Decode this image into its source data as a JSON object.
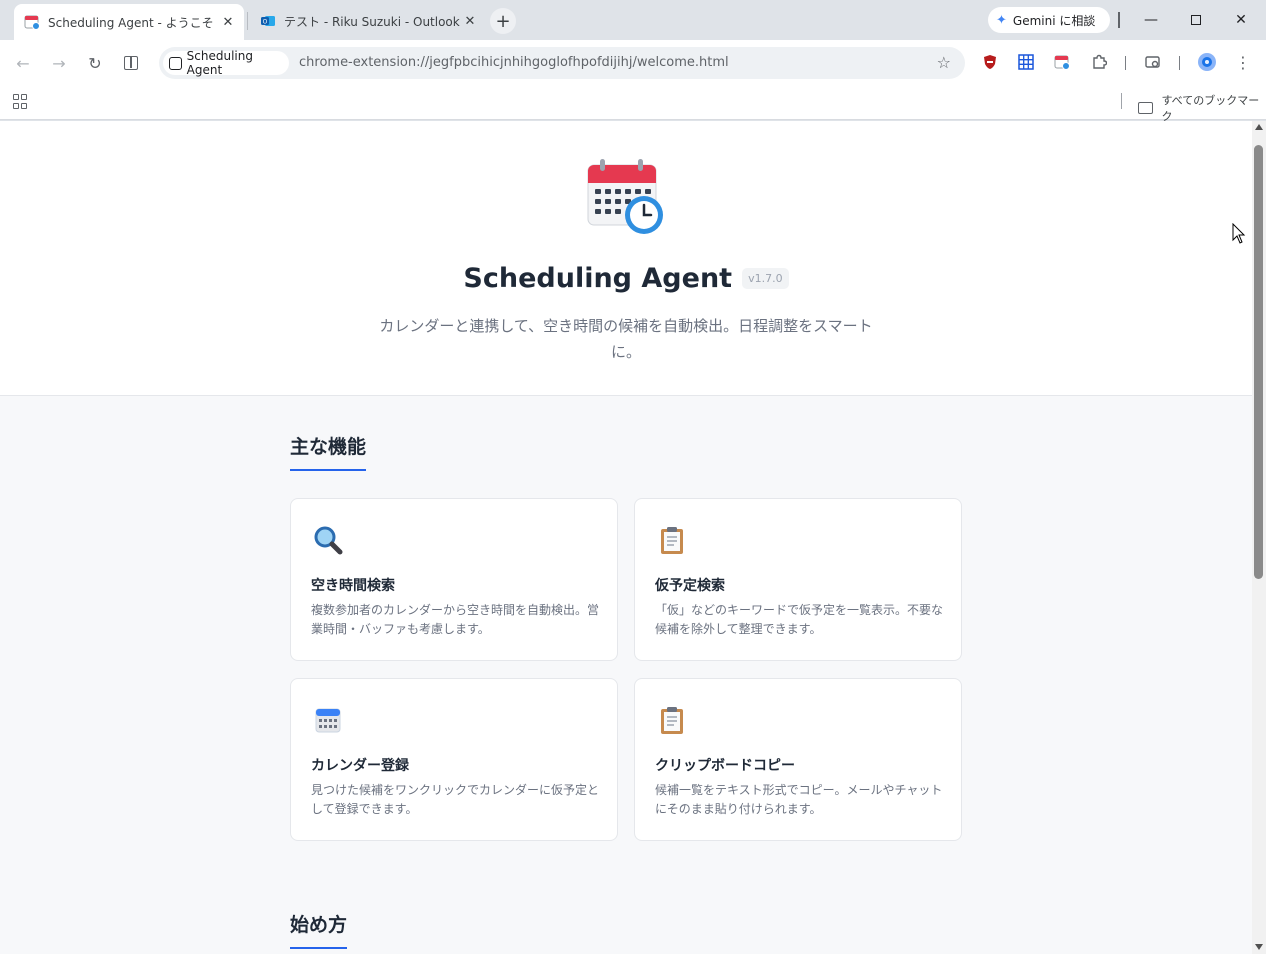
{
  "browser": {
    "tabs": [
      {
        "title": "Scheduling Agent - ようこそ",
        "active": true
      },
      {
        "title": "テスト - Riku Suzuki - Outlook",
        "active": false
      }
    ],
    "gemini_label": "Gemini に相談",
    "site_chip": "Scheduling Agent",
    "url": "chrome-extension://jegfpbcihicjnhihgoglofhpofdijihj/welcome.html",
    "all_bookmarks": "すべてのブックマーク"
  },
  "hero": {
    "title": "Scheduling Agent",
    "version": "v1.7.0",
    "tagline": "カレンダーと連携して、空き時間の候補を自動検出。日程調整をスマートに。"
  },
  "features": {
    "heading": "主な機能",
    "cards": [
      {
        "icon": "magnifier-icon",
        "title": "空き時間検索",
        "desc": "複数参加者のカレンダーから空き時間を自動検出。営業時間・バッファも考慮します。"
      },
      {
        "icon": "clipboard-icon",
        "title": "仮予定検索",
        "desc": "「仮」などのキーワードで仮予定を一覧表示。不要な候補を除外して整理できます。"
      },
      {
        "icon": "calendar-icon",
        "title": "カレンダー登録",
        "desc": "見つけた候補をワンクリックでカレンダーに仮予定として登録できます。"
      },
      {
        "icon": "clipboard-icon",
        "title": "クリップボードコピー",
        "desc": "候補一覧をテキスト形式でコピー。メールやチャットにそのまま貼り付けられます。"
      }
    ]
  },
  "getting_started": {
    "heading": "始め方"
  },
  "colors": {
    "accent": "#2563eb",
    "calendar_red": "#e53950",
    "clock_blue": "#2f8fe0"
  }
}
